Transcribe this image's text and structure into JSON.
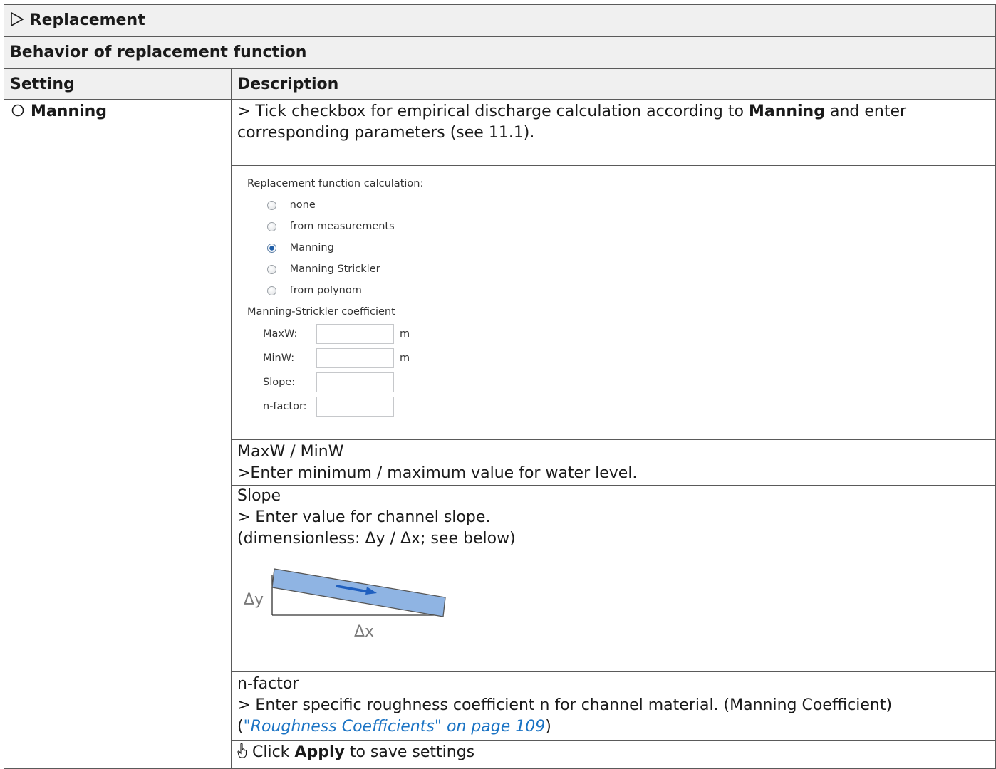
{
  "header": {
    "title_icon": "triangle-right-outline-icon",
    "title": "Replacement"
  },
  "section": {
    "title": "Behavior of replacement function"
  },
  "columns": {
    "setting": "Setting",
    "description": "Description"
  },
  "setting": {
    "radio_icon": "radio-empty-icon",
    "label": "Manning"
  },
  "description": {
    "intro_prefix": "> Tick checkbox for empirical discharge calculation according to ",
    "intro_bold": "Manning",
    "intro_suffix": " and enter",
    "intro_line2": "corresponding parameters (see 11.1)."
  },
  "form": {
    "calc_label": "Replacement function calculation:",
    "options": [
      {
        "label": "none",
        "selected": false
      },
      {
        "label": "from measurements",
        "selected": false
      },
      {
        "label": "Manning",
        "selected": true
      },
      {
        "label": "Manning Strickler",
        "selected": false
      },
      {
        "label": "from polynom",
        "selected": false
      }
    ],
    "coeff_label": "Manning-Strickler coefficient",
    "fields": [
      {
        "label": "MaxW:",
        "value": "",
        "unit": "m"
      },
      {
        "label": "MinW:",
        "value": "",
        "unit": "m"
      },
      {
        "label": "Slope:",
        "value": "",
        "unit": ""
      },
      {
        "label": "n-factor:",
        "value": "",
        "unit": ""
      }
    ]
  },
  "maxmin": {
    "title": "MaxW / MinW",
    "text": ">Enter minimum / maximum value for water level."
  },
  "slope": {
    "title": "Slope",
    "text1": " > Enter value for channel slope.",
    "text2": "(dimensionless: Δy / Δx; see below)",
    "dy": "Δy",
    "dx": "Δx",
    "fill_color": "#8fb4e3",
    "arrow_color": "#1f5fbf"
  },
  "nfactor": {
    "title": "n-factor",
    "text": "> Enter specific roughness coefficient n for channel material. (Manning Coefficient)",
    "ref_open": "(",
    "ref_link": "\"Roughness Coefficients\" on page 109",
    "ref_close": ")"
  },
  "footer": {
    "icon": "hand-pointer-icon",
    "prefix": " Click ",
    "bold": "Apply",
    "suffix": " to save settings"
  }
}
